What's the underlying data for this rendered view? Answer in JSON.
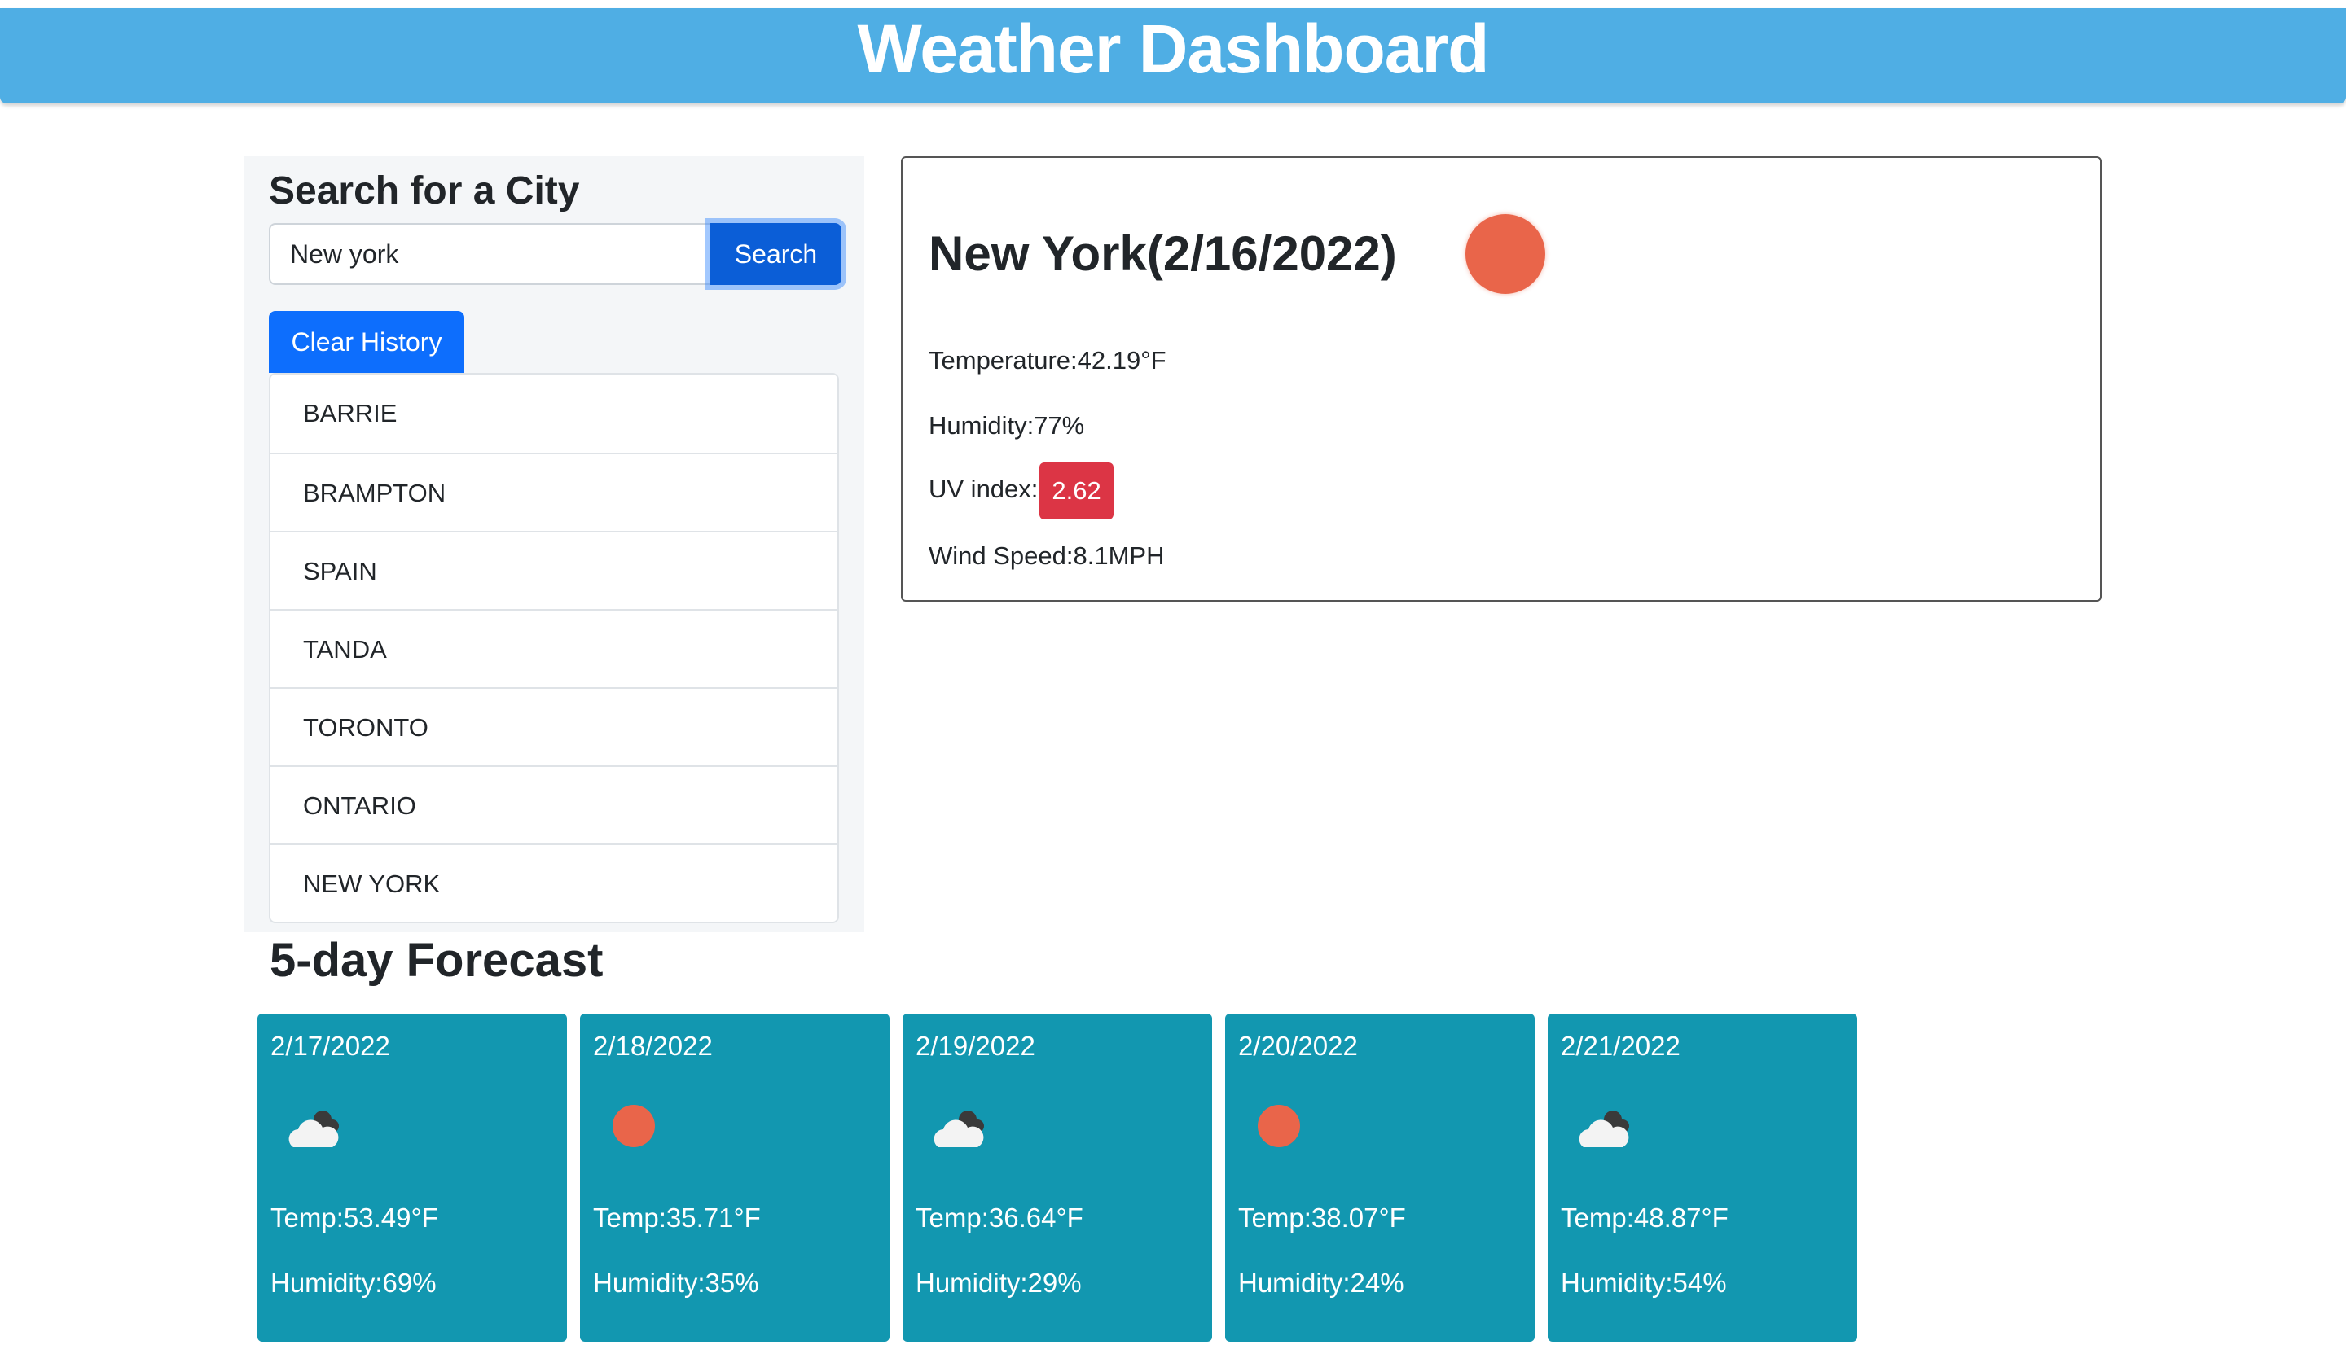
{
  "header": {
    "title": "Weather Dashboard"
  },
  "sidebar": {
    "heading": "Search for a City",
    "search": {
      "value": "New york",
      "placeholder": "",
      "button_label": "Search"
    },
    "clear_label": "Clear History",
    "history": [
      {
        "label": "BARRIE"
      },
      {
        "label": "BRAMPTON"
      },
      {
        "label": "SPAIN"
      },
      {
        "label": "TANDA"
      },
      {
        "label": "TORONTO"
      },
      {
        "label": "ONTARIO"
      },
      {
        "label": "NEW YORK"
      }
    ]
  },
  "current": {
    "title": "New York(2/16/2022)",
    "icon": "sun-icon",
    "temperature": "Temperature:42.19°F",
    "humidity": "Humidity:77%",
    "uv_label": "UV index:",
    "uv_value": "2.62",
    "wind": "Wind Speed:8.1MPH"
  },
  "forecast": {
    "heading": "5-day Forecast",
    "days": [
      {
        "date": "2/17/2022",
        "icon": "cloud-icon",
        "temp": "Temp:53.49°F",
        "humidity": "Humidity:69%"
      },
      {
        "date": "2/18/2022",
        "icon": "sun-icon",
        "temp": "Temp:35.71°F",
        "humidity": "Humidity:35%"
      },
      {
        "date": "2/19/2022",
        "icon": "cloud-icon",
        "temp": "Temp:36.64°F",
        "humidity": "Humidity:29%"
      },
      {
        "date": "2/20/2022",
        "icon": "sun-icon",
        "temp": "Temp:38.07°F",
        "humidity": "Humidity:24%"
      },
      {
        "date": "2/21/2022",
        "icon": "cloud-icon",
        "temp": "Temp:48.87°F",
        "humidity": "Humidity:54%"
      }
    ]
  },
  "colors": {
    "header": "#4faee4",
    "primary_button": "#0d6efd",
    "uv_badge": "#dc3545",
    "forecast_card": "#1297b0",
    "sun": "#e9654a"
  }
}
